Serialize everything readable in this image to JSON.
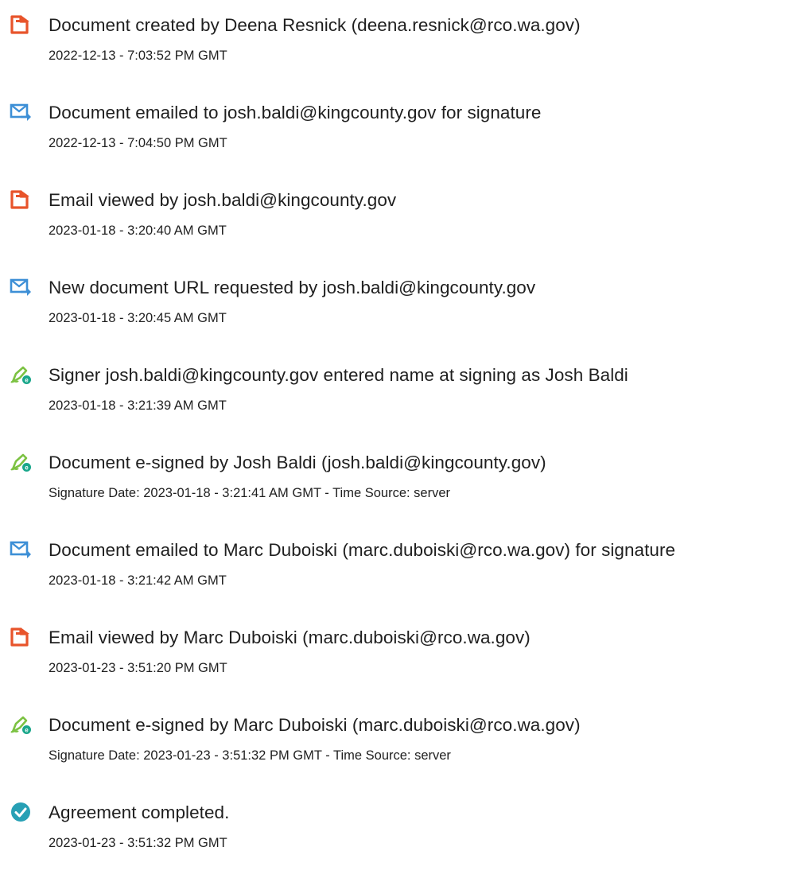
{
  "colors": {
    "doc_icon": "#e8542b",
    "mail_icon": "#3d8fd6",
    "sign_icon": "#7cc242",
    "sign_badge": "#1aa78b",
    "check_icon": "#27a0b5"
  },
  "events": [
    {
      "icon": "document-icon",
      "title": "Document created by Deena Resnick (deena.resnick@rco.wa.gov)",
      "time": "2022-12-13 - 7:03:52 PM GMT"
    },
    {
      "icon": "email-icon",
      "title": "Document emailed to josh.baldi@kingcounty.gov for signature",
      "time": "2022-12-13 - 7:04:50 PM GMT"
    },
    {
      "icon": "document-icon",
      "title": "Email viewed by josh.baldi@kingcounty.gov",
      "time": "2023-01-18 - 3:20:40 AM GMT"
    },
    {
      "icon": "email-icon",
      "title": "New document URL requested by josh.baldi@kingcounty.gov",
      "time": "2023-01-18 - 3:20:45 AM GMT"
    },
    {
      "icon": "signature-pen-icon",
      "title": "Signer josh.baldi@kingcounty.gov entered name at signing as Josh Baldi",
      "time": "2023-01-18 - 3:21:39 AM GMT"
    },
    {
      "icon": "signature-pen-icon",
      "title": "Document e-signed by Josh Baldi (josh.baldi@kingcounty.gov)",
      "time": "Signature Date: 2023-01-18 - 3:21:41 AM GMT - Time Source: server"
    },
    {
      "icon": "email-icon",
      "title": "Document emailed to Marc Duboiski (marc.duboiski@rco.wa.gov) for signature",
      "time": "2023-01-18 - 3:21:42 AM GMT"
    },
    {
      "icon": "document-icon",
      "title": "Email viewed by Marc Duboiski (marc.duboiski@rco.wa.gov)",
      "time": "2023-01-23 - 3:51:20 PM GMT"
    },
    {
      "icon": "signature-pen-icon",
      "title": "Document e-signed by Marc Duboiski (marc.duboiski@rco.wa.gov)",
      "time": "Signature Date: 2023-01-23 - 3:51:32 PM GMT - Time Source: server"
    },
    {
      "icon": "checkmark-circle-icon",
      "title": "Agreement completed.",
      "time": "2023-01-23 - 3:51:32 PM GMT"
    }
  ]
}
